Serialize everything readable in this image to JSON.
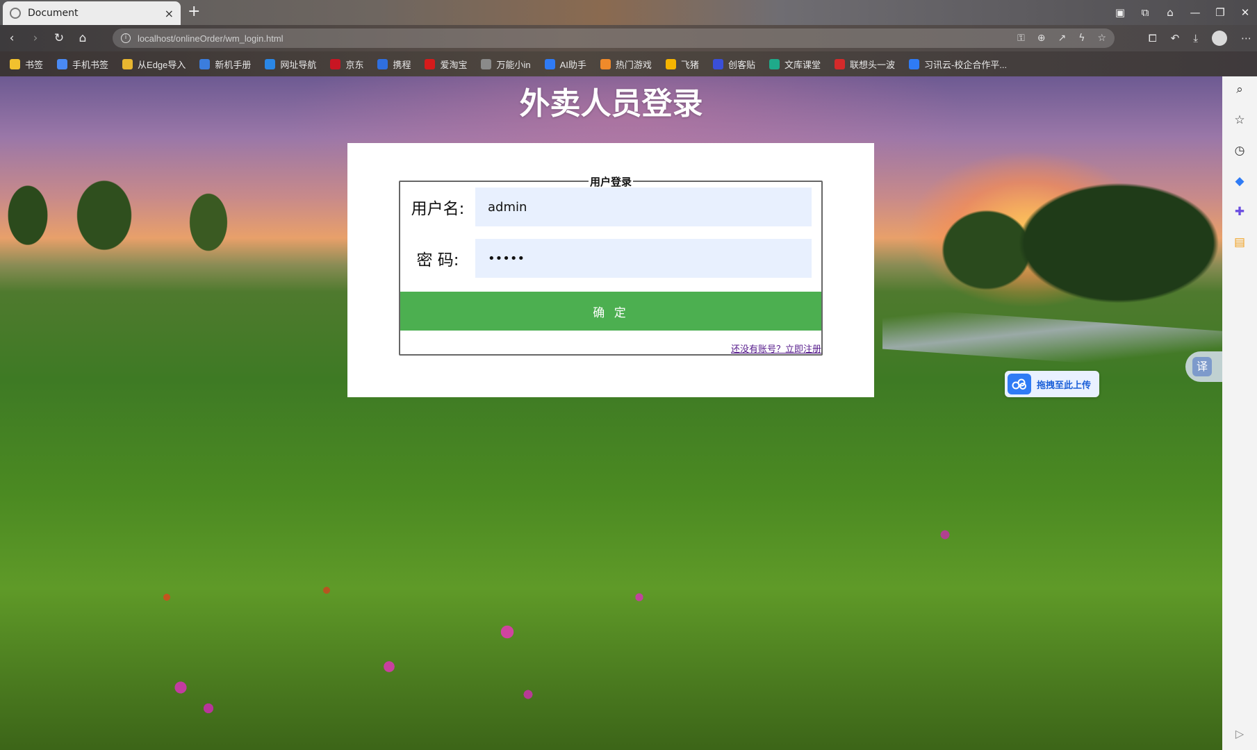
{
  "browser": {
    "tab_title": "Document",
    "tab_close": "×",
    "new_tab": "+",
    "address": "localhost/onlineOrder/wm_login.html",
    "bookmarks": [
      {
        "label": "书签",
        "color": "#f2c12e"
      },
      {
        "label": "手机书签",
        "color": "#4a8af4"
      },
      {
        "label": "从Edge导入",
        "color": "#e8b630"
      },
      {
        "label": "新机手册",
        "color": "#3b7ddd"
      },
      {
        "label": "网址导航",
        "color": "#2a87e6"
      },
      {
        "label": "京东",
        "color": "#c81623"
      },
      {
        "label": "携程",
        "color": "#2f6fe0"
      },
      {
        "label": "爱淘宝",
        "color": "#d61b1b"
      },
      {
        "label": "万能小in",
        "color": "#8a8a8a"
      },
      {
        "label": "AI助手",
        "color": "#2f7bf5"
      },
      {
        "label": "热门游戏",
        "color": "#f08a2a"
      },
      {
        "label": "飞猪",
        "color": "#f5b400"
      },
      {
        "label": "创客贴",
        "color": "#3a4fd8"
      },
      {
        "label": "文库课堂",
        "color": "#1faa8a"
      },
      {
        "label": "联想头一波",
        "color": "#d42a2a"
      },
      {
        "label": "习讯云-校企合作平...",
        "color": "#2f7bf5"
      }
    ]
  },
  "page": {
    "title": "外卖人员登录",
    "legend": "用户登录",
    "username_label": "用户名:",
    "username_value": "admin",
    "password_label": "密 码:",
    "password_value": "•••••",
    "submit_label": "确 定",
    "register_link": "还没有账号？立即注册"
  },
  "overlay": {
    "upload_text": "拖拽至此上传",
    "translate_glyph": "译"
  },
  "colors": {
    "submit_bg": "#4caf50",
    "input_bg": "#e8f0fe",
    "link": "#551a8b"
  }
}
